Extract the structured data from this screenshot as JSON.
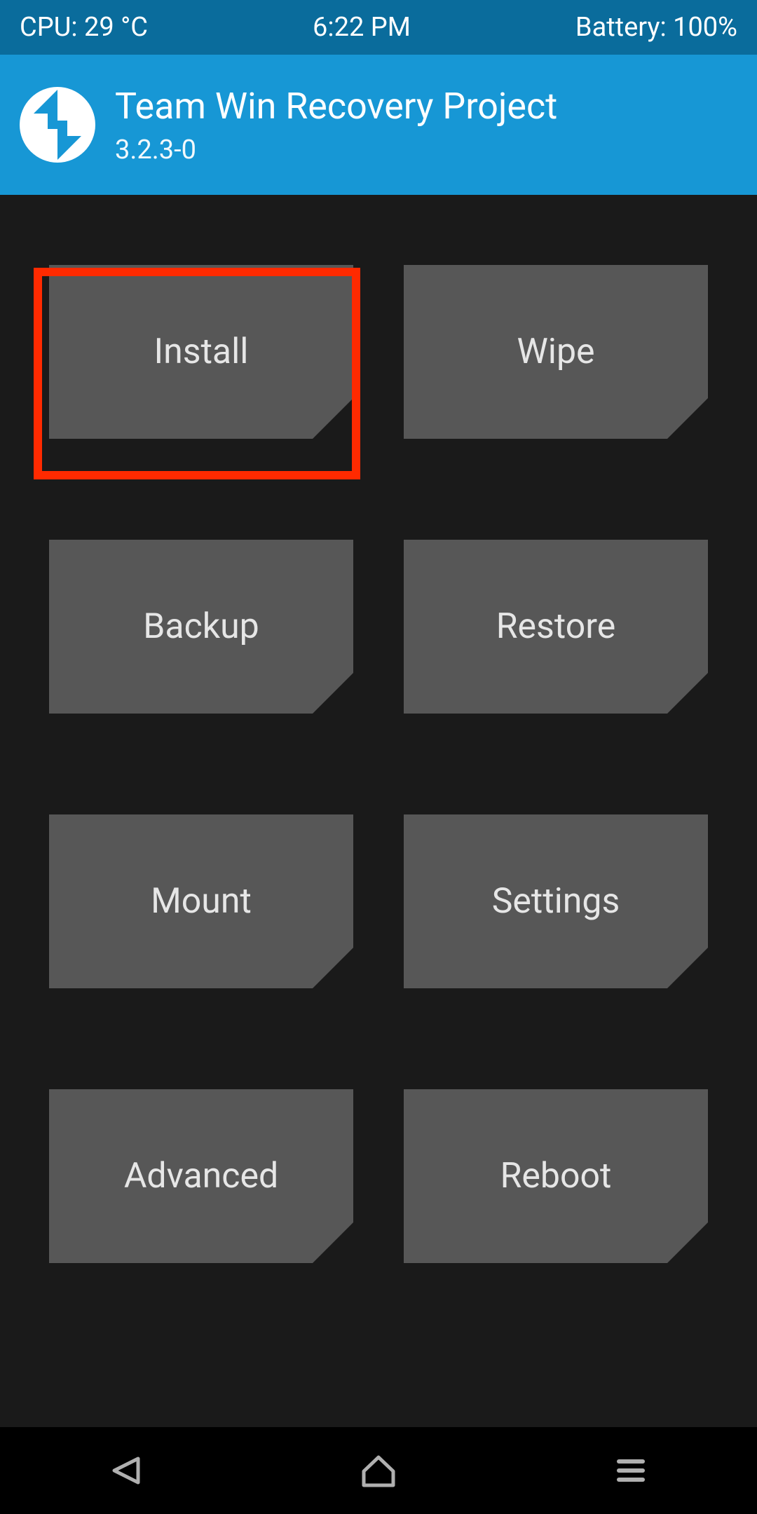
{
  "status": {
    "cpu": "CPU: 29 °C",
    "time": "6:22 PM",
    "battery": "Battery: 100%"
  },
  "header": {
    "title": "Team Win Recovery Project",
    "version": "3.2.3-0"
  },
  "tiles": {
    "install": "Install",
    "wipe": "Wipe",
    "backup": "Backup",
    "restore": "Restore",
    "mount": "Mount",
    "settings": "Settings",
    "advanced": "Advanced",
    "reboot": "Reboot"
  },
  "highlighted": "install"
}
